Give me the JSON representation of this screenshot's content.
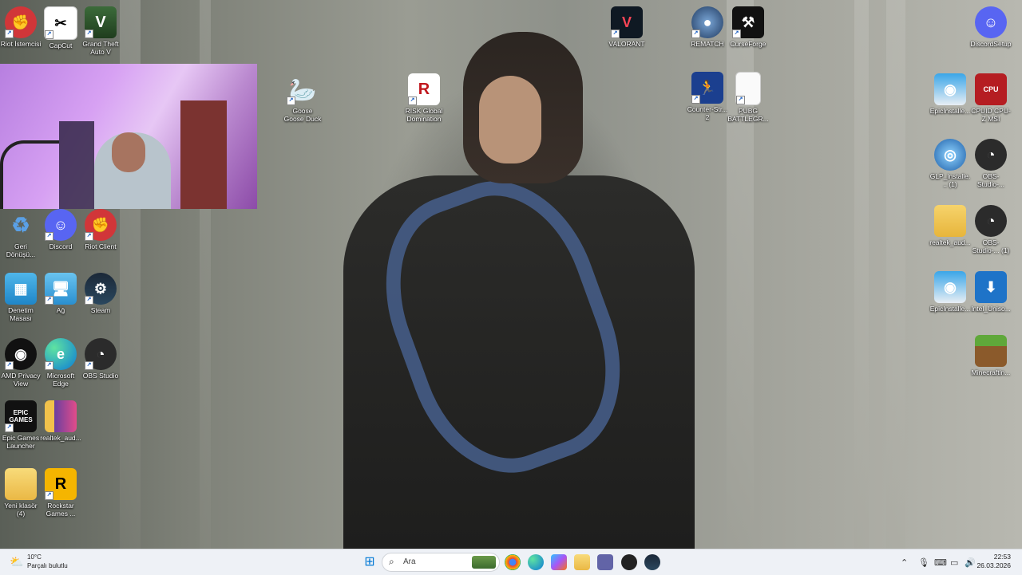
{
  "desktop_icons": {
    "riot_istemcisi": "Riot İstemcisi",
    "capcut": "CapCut",
    "gta": "Grand Theft Auto V",
    "valorant": "VALORANT",
    "rematch": "REMATCH",
    "curseforge": "CurseForge",
    "discord_setup": "DiscordSetup",
    "goose": "Goose Goose Duck",
    "risk": "RISK Global Domination",
    "counter_strike": "Counter-Str... 2",
    "pubg": "PUBG BATTLEGR...",
    "epic_installer_1": "EpicInstalle...",
    "cpuid": "CPUID CPU-Z MSI",
    "glp_installer": "GLP_installe... (1)",
    "obs_studio_1": "OBS-Studio-...",
    "realtek_audio_right": "realtek_aud...",
    "obs_studio_2": "OBS-Studio-... (1)",
    "epic_installer_2": "EpicInstalle...",
    "intel_uniso": "Intel_Uniso...",
    "minecraft": "Minecraftin...",
    "geri_donusum": "Geri Dönüşü...",
    "discord": "Discord",
    "riot_client": "Riot Client",
    "denetim_masasi": "Denetim Masası",
    "ag": "Ağ",
    "steam": "Steam",
    "amd_privacy": "AMD Privacy View",
    "edge": "Microsoft Edge",
    "obs_studio": "OBS Studio",
    "epic_games": "Epic Games Launcher",
    "realtek_audio_left": "realtek_aud...",
    "yeni_klasor": "Yeni klasör (4)",
    "rockstar": "Rockstar Games ..."
  },
  "icon_glyphs": {
    "epic": "EPIC GAMES",
    "rockstar": "R"
  },
  "taskbar": {
    "weather_temp": "10°C",
    "weather_desc": "Parçalı bulutlu",
    "search_placeholder": "Ara",
    "time": "22:53",
    "date": "26.03.2026"
  },
  "colors": {
    "riot_red": "#d13639",
    "discord_blurple": "#5865f2",
    "taskbar_bg": "#eef1f6",
    "windows_blue": "#0078d4"
  }
}
